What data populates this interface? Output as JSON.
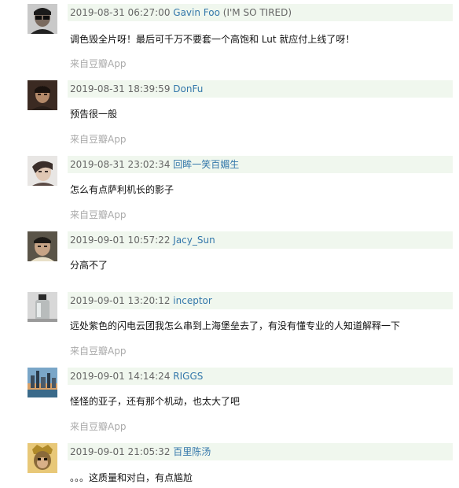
{
  "comments": [
    {
      "time": "2019-08-31 06:27:00",
      "author": "Gavin Foo",
      "author_note": "(I'M SO TIRED)",
      "text": "调色毁全片呀！最后可千万不要套一个高饱和 Lut 就应付上线了呀！",
      "source": "来自豆瓣App",
      "avatar": "avatar-sunglasses"
    },
    {
      "time": "2019-08-31 18:39:59",
      "author": "DonFu",
      "author_note": "",
      "text": "预告很一般",
      "source": "来自豆瓣App",
      "avatar": "avatar-portrait"
    },
    {
      "time": "2019-08-31 23:02:34",
      "author": "回眸一笑百媚生",
      "author_note": "",
      "text": "怎么有点萨利机长的影子",
      "source": "来自豆瓣App",
      "avatar": "avatar-face"
    },
    {
      "time": "2019-09-01 10:57:22",
      "author": "Jacy_Sun",
      "author_note": "",
      "text": "分高不了",
      "source": "",
      "avatar": "avatar-man"
    },
    {
      "time": "2019-09-01 13:20:12",
      "author": "inceptor",
      "author_note": "",
      "text": "远处紫色的闪电云团我怎么串到上海堡垒去了，有没有懂专业的人知道解释一下",
      "source": "来自豆瓣App",
      "avatar": "avatar-bottle"
    },
    {
      "time": "2019-09-01 14:14:24",
      "author": "RIGGS",
      "author_note": "",
      "text": "怪怪的亚子，还有那个机动，也太大了吧",
      "source": "来自豆瓣App",
      "avatar": "avatar-city"
    },
    {
      "time": "2019-09-01 21:05:32",
      "author": "百里陈汤",
      "author_note": "",
      "text": "。。。这质量和对白，有点尴尬",
      "source": "",
      "avatar": "avatar-monkey"
    }
  ],
  "colors": {
    "meta_bg": "#f0f7ee",
    "author_link": "#3377aa",
    "source_text": "#aaaaaa"
  }
}
